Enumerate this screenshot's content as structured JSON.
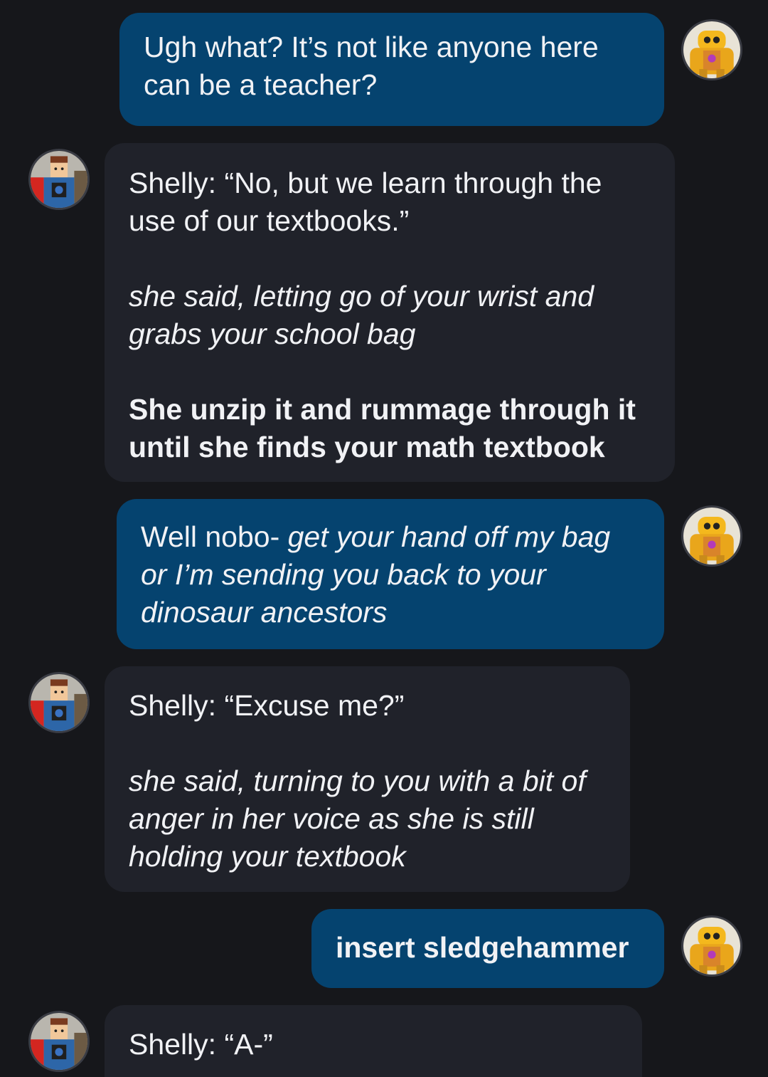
{
  "messages": [
    {
      "role": "user",
      "avatar": "yellow-robot-avatar",
      "paragraphs": [
        {
          "style": "normal",
          "runs": [
            {
              "style": "normal",
              "text": "Ugh what? It’s not like anyone here can be a teacher?"
            }
          ]
        }
      ]
    },
    {
      "role": "character",
      "avatar": "shelly-avatar",
      "paragraphs": [
        {
          "style": "normal",
          "runs": [
            {
              "style": "normal",
              "text": "Shelly: “No, but we learn through the use of our textbooks.”"
            }
          ]
        },
        {
          "style": "italic",
          "runs": [
            {
              "style": "italic",
              "text": "she said, letting go of your wrist and grabs your school bag"
            }
          ]
        },
        {
          "style": "bold",
          "runs": [
            {
              "style": "bold",
              "text": "She unzip it and rummage through it until she finds your math textbook"
            }
          ]
        }
      ]
    },
    {
      "role": "user",
      "avatar": "yellow-robot-avatar",
      "paragraphs": [
        {
          "style": "mixed",
          "runs": [
            {
              "style": "normal",
              "text": "Well nobo- "
            },
            {
              "style": "italic",
              "text": "get your hand off my bag or I’m sending you back to your dinosaur ancestors"
            }
          ]
        }
      ]
    },
    {
      "role": "character",
      "avatar": "shelly-avatar",
      "paragraphs": [
        {
          "style": "normal",
          "runs": [
            {
              "style": "normal",
              "text": "Shelly: “Excuse me?”"
            }
          ]
        },
        {
          "style": "italic",
          "runs": [
            {
              "style": "italic",
              "text": "she said, turning to you with a bit of anger in her voice as she is still holding your textbook"
            }
          ]
        }
      ]
    },
    {
      "role": "user",
      "avatar": "yellow-robot-avatar",
      "paragraphs": [
        {
          "style": "bold",
          "runs": [
            {
              "style": "bold",
              "text": "insert sledgehammer"
            }
          ]
        }
      ]
    },
    {
      "role": "character",
      "avatar": "shelly-avatar",
      "paragraphs": [
        {
          "style": "normal",
          "runs": [
            {
              "style": "normal",
              "text": "Shelly: “A-”"
            }
          ]
        }
      ]
    }
  ],
  "colors": {
    "background": "#16171b",
    "user_bubble": "#05436f",
    "character_bubble": "#20222a",
    "text": "#f1f2f5"
  }
}
